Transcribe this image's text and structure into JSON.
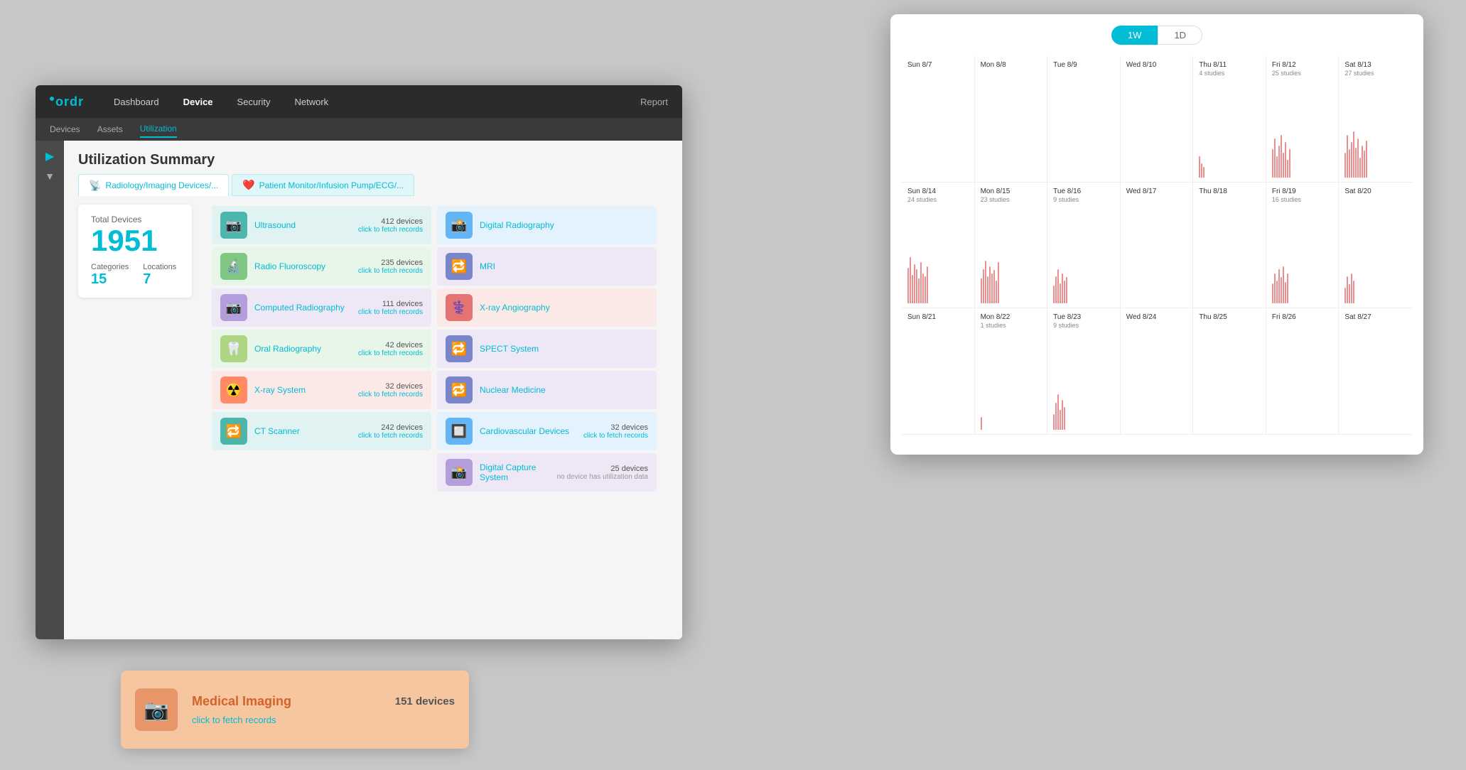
{
  "app": {
    "logo": "ordr",
    "nav_items": [
      "Dashboard",
      "Device",
      "Security",
      "Network"
    ],
    "active_nav": "Device",
    "reports_label": "Report"
  },
  "sub_nav": {
    "items": [
      "Devices",
      "Assets",
      "Utilization"
    ],
    "active": "Utilization"
  },
  "page": {
    "title": "Utilization Summary"
  },
  "tabs": [
    {
      "label": "Radiology/Imaging Devices/...",
      "icon": "📡",
      "active": true
    },
    {
      "label": "Patient Monitor/Infusion Pump/ECG/...",
      "icon": "❤️",
      "active": false
    }
  ],
  "stats": {
    "total_label": "Total Devices",
    "total_value": "1951",
    "categories_label": "Categories",
    "categories_value": "15",
    "locations_label": "Locations",
    "locations_value": "7"
  },
  "devices": [
    {
      "name": "Ultrasound",
      "count": "412 devices",
      "fetch": "click to fetch records",
      "icon": "📷",
      "bg": "bg-teal",
      "card": "card-teal"
    },
    {
      "name": "Digital Radiography",
      "count": "",
      "fetch": "",
      "icon": "📸",
      "bg": "bg-blue",
      "card": "card-blue"
    },
    {
      "name": "Radio Fluoroscopy",
      "count": "235 devices",
      "fetch": "click to fetch records",
      "icon": "🔬",
      "bg": "bg-green",
      "card": "card-green"
    },
    {
      "name": "MRI",
      "count": "",
      "fetch": "",
      "icon": "🔁",
      "bg": "bg-indigo",
      "card": "card-purple"
    },
    {
      "name": "Computed Radiography",
      "count": "111 devices",
      "fetch": "click to fetch records",
      "icon": "📷",
      "bg": "bg-purple-light",
      "card": "card-purple"
    },
    {
      "name": "X-ray Angiography",
      "count": "",
      "fetch": "",
      "icon": "⚕️",
      "bg": "bg-red",
      "card": "card-orange"
    },
    {
      "name": "Oral Radiography",
      "count": "42 devices",
      "fetch": "click to fetch records",
      "icon": "🦷",
      "bg": "bg-lime",
      "card": "card-green"
    },
    {
      "name": "SPECT System",
      "count": "",
      "fetch": "",
      "icon": "🔁",
      "bg": "bg-indigo",
      "card": "card-purple"
    },
    {
      "name": "X-ray System",
      "count": "32 devices",
      "fetch": "click to fetch records",
      "icon": "☢️",
      "bg": "bg-orange",
      "card": "card-orange"
    },
    {
      "name": "Nuclear Medicine",
      "count": "",
      "fetch": "",
      "icon": "🔁",
      "bg": "bg-indigo",
      "card": "card-purple"
    },
    {
      "name": "CT Scanner",
      "count": "242 devices",
      "fetch": "click to fetch records",
      "icon": "🔁",
      "bg": "bg-teal",
      "card": "card-teal"
    },
    {
      "name": "Cardiovascular Devices",
      "count": "32 devices",
      "fetch": "click to fetch records",
      "icon": "🔲",
      "bg": "bg-blue",
      "card": "card-blue"
    },
    {
      "name": "Digital Capture System",
      "count": "25 devices",
      "fetch": "no device has utilization data",
      "icon": "📸",
      "bg": "bg-purple-light",
      "card": "card-purple"
    }
  ],
  "medical_imaging": {
    "name": "Medical Imaging",
    "count": "151 devices",
    "fetch": "click to fetch records",
    "icon": "📷"
  },
  "chart": {
    "tabs": [
      "1W",
      "1D"
    ],
    "active_tab": "1W",
    "weeks": [
      {
        "days": [
          {
            "label": "Sun 8/7",
            "studies": "",
            "bars": []
          },
          {
            "label": "Mon 8/8",
            "studies": "",
            "bars": []
          },
          {
            "label": "Tue 8/9",
            "studies": "",
            "bars": []
          },
          {
            "label": "Wed 8/10",
            "studies": "",
            "bars": []
          },
          {
            "label": "Thu 8/11",
            "studies": "4 studies",
            "bars": [
              15,
              10,
              8
            ]
          },
          {
            "label": "Fri 8/12",
            "studies": "25 studies",
            "bars": [
              30,
              45,
              20,
              35,
              50,
              25,
              40,
              15,
              30
            ]
          },
          {
            "label": "Sat 8/13",
            "studies": "27 studies",
            "bars": [
              25,
              55,
              30,
              45,
              60,
              35,
              50,
              20,
              40,
              30,
              45
            ]
          }
        ]
      },
      {
        "days": [
          {
            "label": "Sun 8/14",
            "studies": "24 studies",
            "bars": [
              40,
              60,
              35,
              50,
              45,
              30,
              55,
              40,
              35,
              50
            ]
          },
          {
            "label": "Mon 8/15",
            "studies": "23 studies",
            "bars": [
              30,
              45,
              55,
              35,
              50,
              40,
              45,
              30,
              55,
              35
            ]
          },
          {
            "label": "Tue 8/16",
            "studies": "9 studies",
            "bars": [
              20,
              35,
              45,
              25,
              40,
              30,
              35
            ]
          },
          {
            "label": "Wed 8/17",
            "studies": "",
            "bars": []
          },
          {
            "label": "Thu 8/18",
            "studies": "",
            "bars": []
          },
          {
            "label": "Fri 8/19",
            "studies": "16 studies",
            "bars": [
              25,
              40,
              30,
              45,
              35,
              50,
              30,
              40
            ]
          },
          {
            "label": "Sat 8/20",
            "studies": "",
            "bars": [
              20,
              35,
              25,
              40,
              30
            ]
          }
        ]
      },
      {
        "days": [
          {
            "label": "Sun 8/21",
            "studies": "",
            "bars": []
          },
          {
            "label": "Mon 8/22",
            "studies": "1 studies",
            "bars": [
              10
            ]
          },
          {
            "label": "Tue 8/23",
            "studies": "9 studies",
            "bars": [
              20,
              35,
              25,
              40,
              30,
              20,
              35
            ]
          },
          {
            "label": "Wed 8/24",
            "studies": "",
            "bars": []
          },
          {
            "label": "Thu 8/25",
            "studies": "",
            "bars": []
          },
          {
            "label": "Fri 8/26",
            "studies": "",
            "bars": []
          },
          {
            "label": "Sat 8/27",
            "studies": "",
            "bars": []
          }
        ]
      }
    ]
  }
}
